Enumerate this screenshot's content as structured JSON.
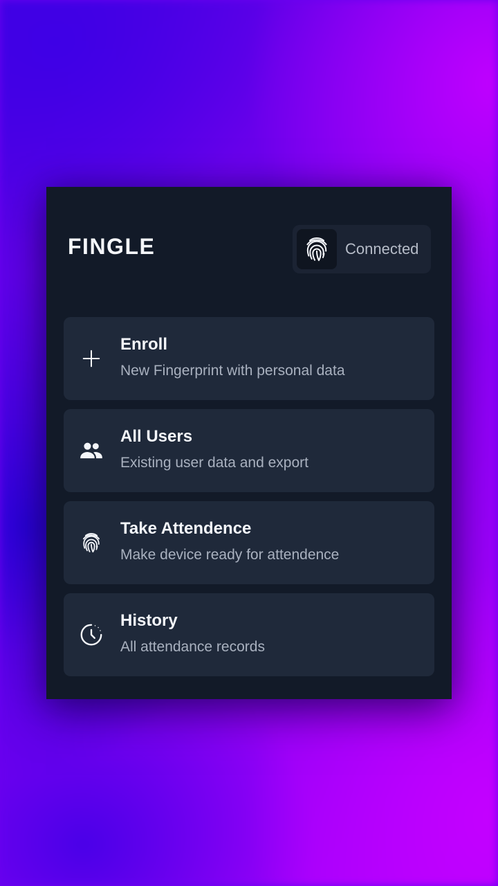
{
  "app": {
    "title": "FINGLE"
  },
  "status": {
    "label": "Connected",
    "icon": "fingerprint-icon"
  },
  "menu": [
    {
      "title": "Enroll",
      "subtitle": "New Fingerprint with personal data",
      "icon": "plus-icon"
    },
    {
      "title": "All Users",
      "subtitle": "Existing user data and export",
      "icon": "users-icon"
    },
    {
      "title": "Take Attendence",
      "subtitle": "Make device ready for attendence",
      "icon": "fingerprint-icon"
    },
    {
      "title": "History",
      "subtitle": "All attendance records",
      "icon": "history-clock-icon"
    }
  ],
  "colors": {
    "card_background": "#121a28",
    "item_background": "#1f293a",
    "text_primary": "#f4f6fa",
    "text_secondary": "#a9b1bf",
    "background_gradient_start": "#4400e0",
    "background_gradient_end": "#b100ff"
  }
}
